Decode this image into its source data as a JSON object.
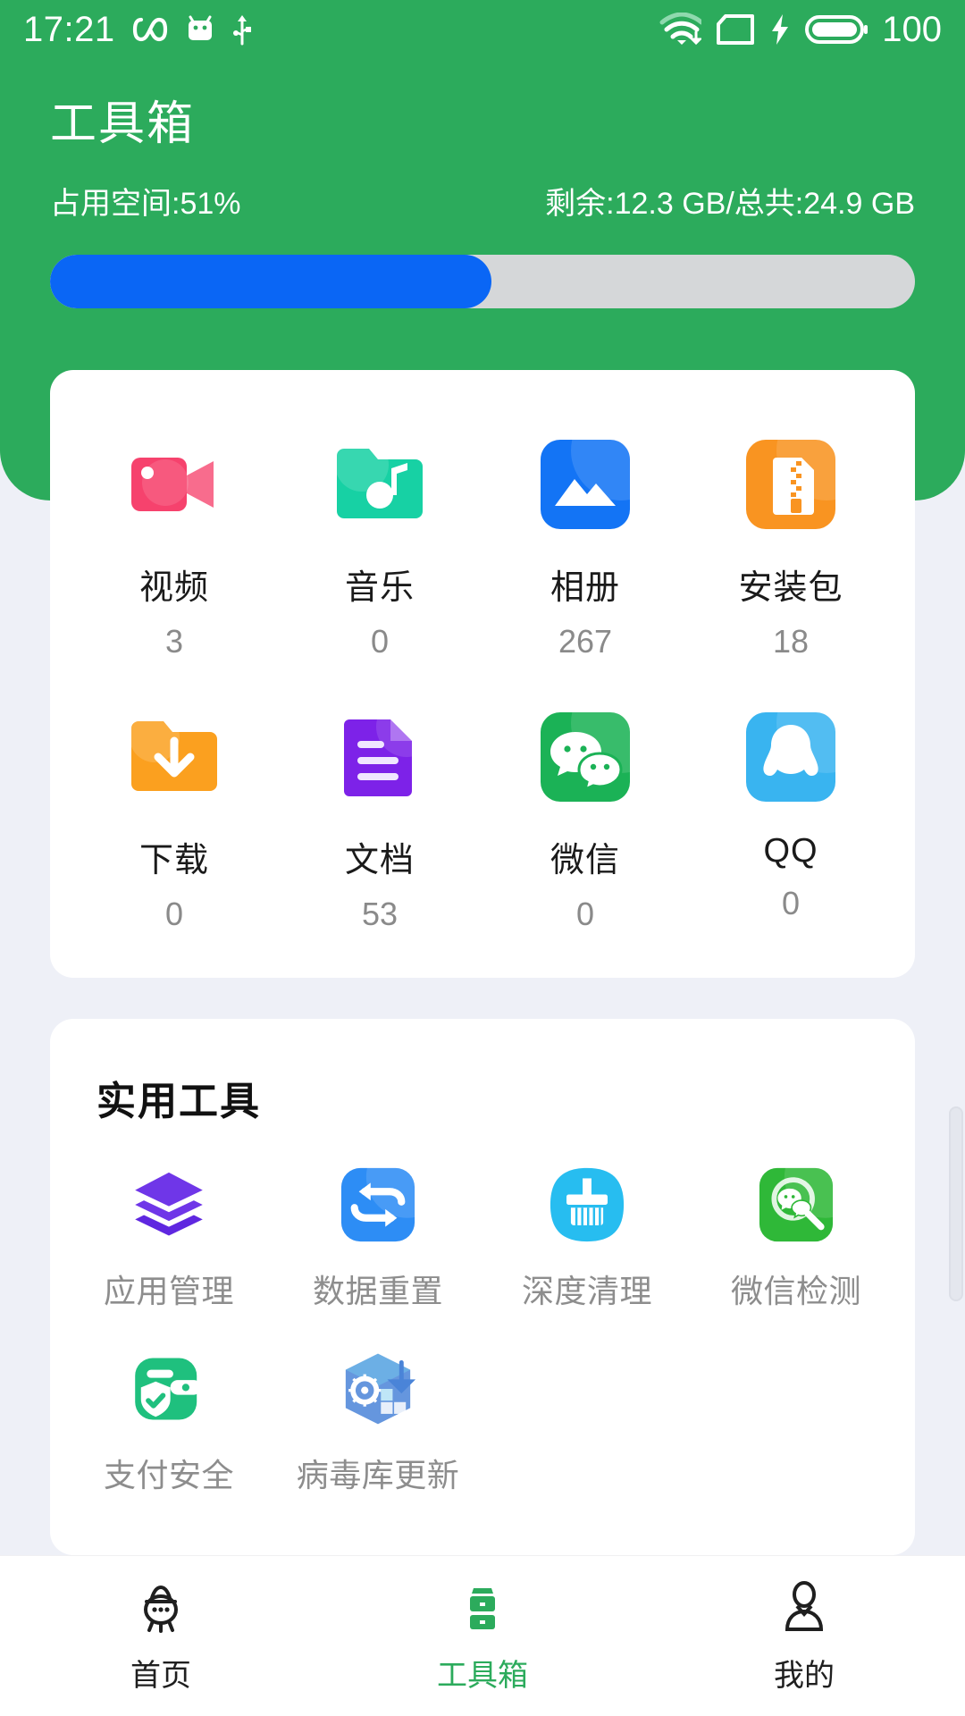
{
  "status_bar": {
    "time": "17:21",
    "left_icons": [
      "infinity-icon",
      "android-robot-icon",
      "usb-icon"
    ],
    "right_icons": [
      "wifi-download-icon",
      "sim-card-icon",
      "charging-bolt-icon",
      "battery-icon"
    ],
    "battery_level": "100"
  },
  "header": {
    "title": "工具箱",
    "storage_used_label": "占用空间:51%",
    "storage_free_label": "剩余:12.3 GB/总共:24.9 GB",
    "progress_percent": 51,
    "bg_color": "#2cab5c",
    "progress_fill_color": "#0a66f5",
    "progress_track_color": "#d5d7d9"
  },
  "categories": [
    {
      "label": "视频",
      "count": "3",
      "icon": "video-camera-icon",
      "color": "#f6426d"
    },
    {
      "label": "音乐",
      "count": "0",
      "icon": "music-folder-icon",
      "color": "#17d1a4"
    },
    {
      "label": "相册",
      "count": "267",
      "icon": "photo-album-icon",
      "color": "#1374f5"
    },
    {
      "label": "安装包",
      "count": "18",
      "icon": "apk-zip-icon",
      "color": "#f99421"
    },
    {
      "label": "下载",
      "count": "0",
      "icon": "download-folder-icon",
      "color": "#fba01f"
    },
    {
      "label": "文档",
      "count": "53",
      "icon": "document-icon",
      "color": "#7d22e8"
    },
    {
      "label": "微信",
      "count": "0",
      "icon": "wechat-icon",
      "color": "#1bb256"
    },
    {
      "label": "QQ",
      "count": "0",
      "icon": "qq-penguin-icon",
      "color": "#39b4f0"
    }
  ],
  "tools": {
    "title": "实用工具",
    "items": [
      {
        "label": "应用管理",
        "icon": "layers-stack-icon",
        "color": "#6f36e8"
      },
      {
        "label": "数据重置",
        "icon": "swap-arrows-icon",
        "color": "#2d8df5"
      },
      {
        "label": "深度清理",
        "icon": "broom-clean-icon",
        "color": "#27bdf0"
      },
      {
        "label": "微信检测",
        "icon": "wechat-scan-icon",
        "color": "#2fb838"
      },
      {
        "label": "支付安全",
        "icon": "wallet-shield-icon",
        "color": "#1fc07e"
      },
      {
        "label": "病毒库更新",
        "icon": "virus-db-update-icon",
        "color": "#4a84d8"
      }
    ]
  },
  "bottom_nav": {
    "active_color": "#2cab5c",
    "items": [
      {
        "label": "首页",
        "icon": "home-rocket-icon",
        "active": false
      },
      {
        "label": "工具箱",
        "icon": "toolbox-icon",
        "active": true
      },
      {
        "label": "我的",
        "icon": "profile-icon",
        "active": false
      }
    ]
  }
}
